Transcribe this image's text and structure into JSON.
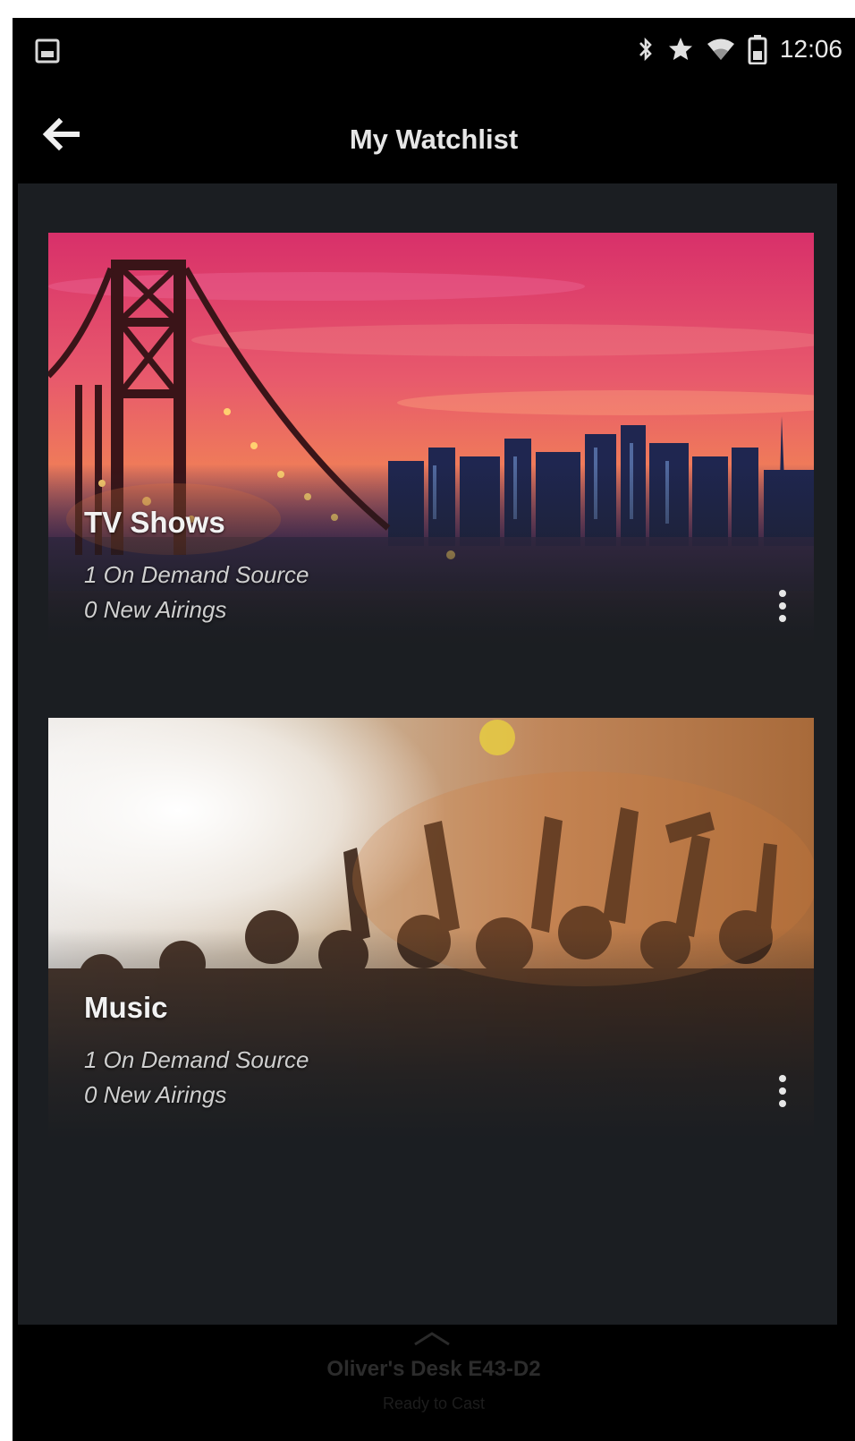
{
  "status_bar": {
    "time": "12:06",
    "icons": [
      "image-notification-icon",
      "bluetooth-icon",
      "star-icon",
      "wifi-icon",
      "battery-icon"
    ]
  },
  "app_bar": {
    "title": "My Watchlist",
    "back_icon": "arrow-left-icon"
  },
  "cards": [
    {
      "title": "TV Shows",
      "line1": "1 On Demand Source",
      "line2": "0 New Airings",
      "image": "bridge-city-sunset",
      "menu_icon": "more-vertical-icon"
    },
    {
      "title": "Music",
      "line1": "1 On Demand Source",
      "line2": "0 New Airings",
      "image": "concert-crowd",
      "menu_icon": "more-vertical-icon"
    }
  ],
  "bottom_bar": {
    "device_name": "Oliver's Desk E43-D2",
    "device_status": "Ready to Cast",
    "icon": "chevron-up-icon"
  }
}
